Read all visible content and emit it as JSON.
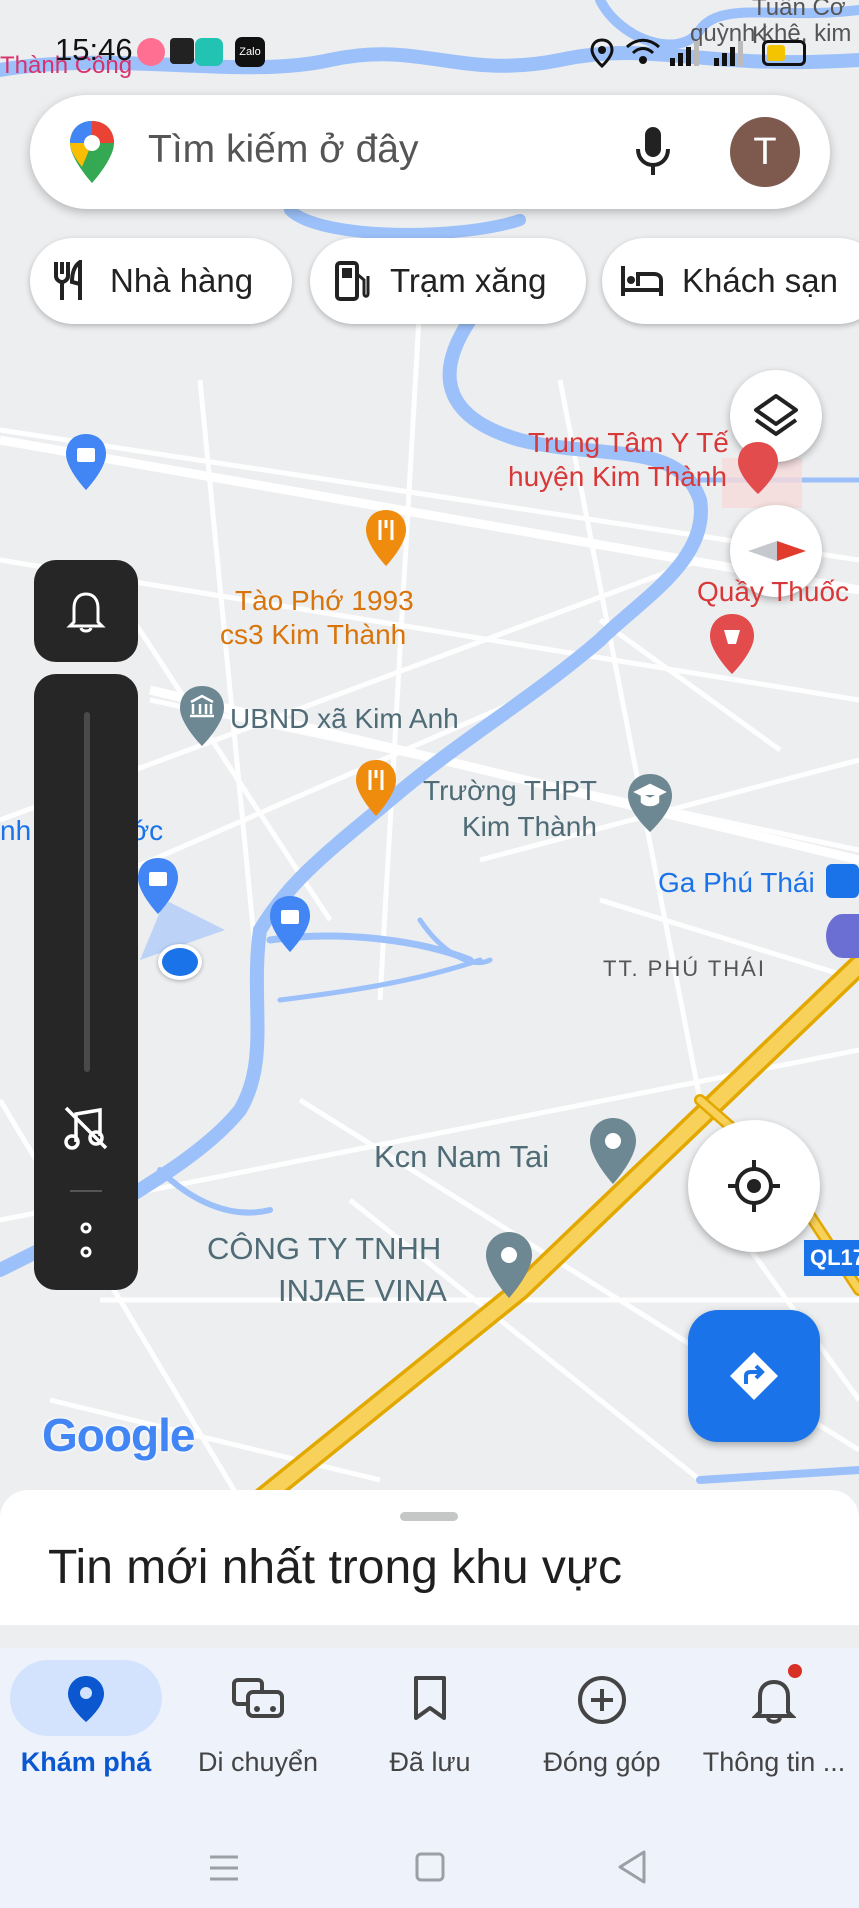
{
  "status_bar": {
    "time": "15:46",
    "app_icon_text": "Zalo",
    "corner_label_left": "Thành Công",
    "corner_label_right_1": "Tuấn Cơ K",
    "corner_label_right_2": "quỳnh khê, kim"
  },
  "search": {
    "placeholder": "Tìm kiếm ở đây",
    "avatar_initial": "T"
  },
  "chips": [
    {
      "label": "Nhà hàng",
      "icon": "restaurant-icon"
    },
    {
      "label": "Trạm xăng",
      "icon": "gas-station-icon"
    },
    {
      "label": "Khách sạn",
      "icon": "hotel-icon"
    }
  ],
  "map_labels": {
    "hospital": [
      "Trung Tâm Y Tế",
      "huyện Kim Thành"
    ],
    "pharmacy": "Quầy Thuốc",
    "restaurant1": [
      "Tào Phớ 1993",
      "cs3 Kim Thành"
    ],
    "ubnd": "UBND xã Kim Anh",
    "school": [
      "Trường THPT",
      "Kim Thành"
    ],
    "loc_nuoc": "nh Lọc Nước",
    "station": "Ga Phú Thái",
    "town": "TT. PHÚ THÁI",
    "industrial": "Kcn Nam Tai",
    "company": [
      "CÔNG TY TNHH",
      "INJAE VINA"
    ],
    "road": "QL17",
    "google": "Google"
  },
  "sheet": {
    "title": "Tin mới nhất trong khu vực"
  },
  "bottom_nav": [
    {
      "label": "Khám phá",
      "icon": "explore-pin-icon",
      "active": true
    },
    {
      "label": "Di chuyển",
      "icon": "commute-icon",
      "active": false
    },
    {
      "label": "Đã lưu",
      "icon": "bookmark-icon",
      "active": false
    },
    {
      "label": "Đóng góp",
      "icon": "add-circle-icon",
      "active": false
    },
    {
      "label": "Thông tin ...",
      "icon": "bell-icon",
      "active": false
    }
  ],
  "colors": {
    "accent": "#1a73e8",
    "restaurant": "#ef8c0d",
    "hospital": "#d93838",
    "poi_gray": "#6e8893",
    "highway": "#f5c542",
    "water": "#9cc0f9"
  }
}
